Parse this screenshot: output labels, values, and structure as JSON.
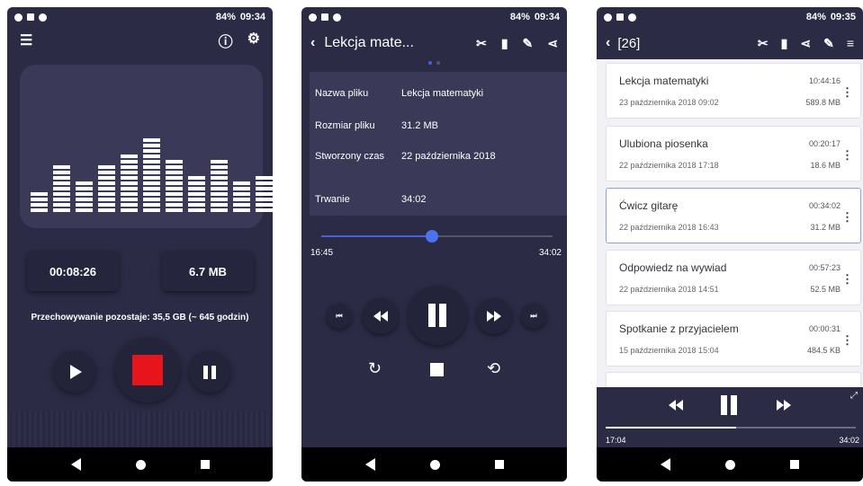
{
  "screen1": {
    "status": {
      "battery": "84%",
      "time": "09:34"
    },
    "elapsed": "00:08:26",
    "size": "6.7 MB",
    "storage_text": "Przechowywanie pozostaje: 35,5 GB (~ 645 godzin)",
    "visualizer_levels": [
      4,
      9,
      6,
      9,
      11,
      14,
      10,
      7,
      10,
      6,
      7,
      11
    ]
  },
  "screen2": {
    "status": {
      "battery": "84%",
      "time": "09:34"
    },
    "title": "Lekcja mate...",
    "details": [
      {
        "label": "Nazwa pliku",
        "value": "Lekcja matematyki"
      },
      {
        "label": "Rozmiar pliku",
        "value": "31.2 MB"
      },
      {
        "label": "Stworzony czas",
        "value": "22 października 2018"
      },
      {
        "label": "Trwanie",
        "value": "34:02"
      }
    ],
    "position": "16:45",
    "duration": "34:02",
    "progress_fraction": 0.48
  },
  "screen3": {
    "status": {
      "battery": "84%",
      "time": "09:35"
    },
    "title": "[26]",
    "recordings": [
      {
        "name": "Lekcja matematyki",
        "date": "23 października 2018  09:02",
        "duration": "10:44:16",
        "size": "589.8 MB"
      },
      {
        "name": "Ulubiona piosenka",
        "date": "22 października 2018  17:18",
        "duration": "00:20:17",
        "size": "18.6 MB"
      },
      {
        "name": "Ćwicz gitarę",
        "date": "22 października 2018  16:43",
        "duration": "00:34:02",
        "size": "31.2 MB"
      },
      {
        "name": "Odpowiedz na wywiad",
        "date": "22 października 2018  14:51",
        "duration": "00:57:23",
        "size": "52.5 MB"
      },
      {
        "name": "Spotkanie z przyjacielem",
        "date": "15 października 2018  15:04",
        "duration": "00:00:31",
        "size": "484.5 KB"
      }
    ],
    "position": "17:04",
    "duration": "34:02",
    "progress_fraction": 0.52
  },
  "icons": {
    "menu": "list-icon",
    "info": "info-icon",
    "settings": "gear-icon",
    "cut": "scissors-icon",
    "delete": "trash-icon",
    "edit": "pencil-icon",
    "share": "share-icon"
  },
  "colors": {
    "background": "#2b2b46",
    "accent": "#4b72f0",
    "record": "#e8141c"
  }
}
